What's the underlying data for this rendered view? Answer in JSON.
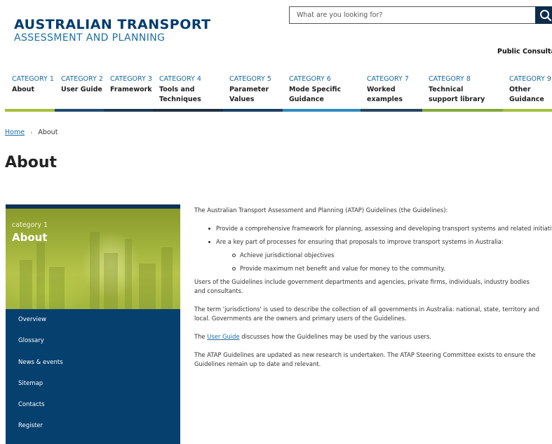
{
  "header": {
    "logo_line1": "AUSTRALIAN TRANSPORT",
    "logo_line2": "ASSESSMENT AND PLANNING",
    "search_placeholder": "What are you looking for?",
    "search_icon": "search-icon",
    "public_consultation": "Public Consultation"
  },
  "nav": {
    "items": [
      {
        "cat": "CATEGORY 1",
        "title": "About"
      },
      {
        "cat": "CATEGORY 2",
        "title": "User Guide"
      },
      {
        "cat": "CATEGORY 3",
        "title": "Framework"
      },
      {
        "cat": "CATEGORY 4",
        "title": "Tools and Techniques"
      },
      {
        "cat": "CATEGORY 5",
        "title": "Parameter Values"
      },
      {
        "cat": "CATEGORY 6",
        "title": "Mode Specific Guidance"
      },
      {
        "cat": "CATEGORY 7",
        "title": "Worked examples"
      },
      {
        "cat": "CATEGORY 8",
        "title": "Technical support library"
      },
      {
        "cat": "CATEGORY 9",
        "title": "Other Guidance"
      }
    ],
    "bar_colors": [
      "#a7c03a",
      "#1f4b6e",
      "#1b3a52",
      "#1e2f3f",
      "#1a3f63",
      "#2e8bc0",
      "#27455f",
      "#81a83a",
      "#a3c13b"
    ]
  },
  "breadcrumb": {
    "home": "Home",
    "separator": "›",
    "current": "About"
  },
  "page_title": "About",
  "sidebar": {
    "category": "category 1",
    "title": "About",
    "links": [
      "Overview",
      "Glossary",
      "News & events",
      "Sitemap",
      "Contacts",
      "Register"
    ]
  },
  "content": {
    "intro": "The Australian Transport Assessment and Planning (ATAP) Guidelines (the Guidelines):",
    "bullet1": "Provide a comprehensive framework for planning, assessing and developing transport systems and related initiatives",
    "bullet2": "Are a key part of processes for ensuring that proposals to improve transport systems in Australia:",
    "sub1": "Achieve jurisdictional objectives",
    "sub2": "Provide maximum net benefit and value for money to the community.",
    "para_users": "Users of the Guidelines include government departments and agencies, private firms, individuals, industry bodies and consultants.",
    "para_jurisdictions": "The term 'jurisdictions' is used to describe the collection of all governments in Australia: national, state, territory and local. Governments are the owners and primary users of the Guidelines.",
    "user_guide_pre": "The ",
    "user_guide_link": "User Guide",
    "user_guide_post": " discusses how the Guidelines may be used by the various users.",
    "para_updated": "The ATAP Guidelines are updated as new research is undertaken.  The ATAP Steering Committee exists to ensure the Guidelines remain up to date and relevant."
  }
}
